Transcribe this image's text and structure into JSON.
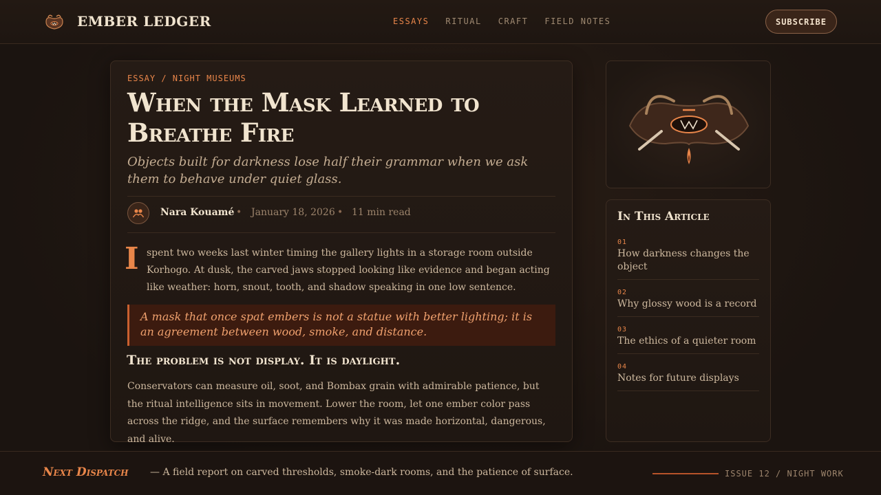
{
  "header": {
    "brand": "EMBER LEDGER",
    "brand_icon": "mask-icon",
    "nav": [
      {
        "label": "ESSAYS",
        "active": true
      },
      {
        "label": "RITUAL",
        "active": false
      },
      {
        "label": "CRAFT",
        "active": false
      },
      {
        "label": "FIELD NOTES",
        "active": false
      }
    ],
    "subscribe_label": "SUBSCRIBE"
  },
  "article": {
    "kicker": "ESSAY / NIGHT MUSEUMS",
    "title": "When the Mask Learned to Breathe Fire",
    "subtitle": "Objects built for darkness lose half their grammar when we ask them to behave under quiet glass.",
    "author": "Nara Kouamé",
    "separator": "•",
    "date": "January 18, 2026",
    "read_time": "11 min read",
    "dropcap": "I",
    "intro": "spent two weeks last winter timing the gallery lights in a storage room outside Korhogo. At dusk, the carved jaws stopped looking like evidence and began acting like weather: horn, snout, tooth, and shadow speaking in one low sentence.",
    "pullquote": "A mask that once spat embers is not a statue with better lighting; it is an agreement between wood, smoke, and distance.",
    "section_heading": "The problem is not display. It is daylight.",
    "body": "Conservators can measure oil, soot, and Bombax grain with admirable patience, but the ritual intelligence sits in movement. Lower the room, let one ember color pass across the ridge, and the surface remembers why it was made horizontal, dangerous, and alive."
  },
  "sidebar": {
    "illustration_icon": "fire-mask-icon",
    "toc_title": "In This Article",
    "toc": [
      {
        "num": "01",
        "label": "How darkness changes the object"
      },
      {
        "num": "02",
        "label": "Why glossy wood is a record"
      },
      {
        "num": "03",
        "label": "The ethics of a quieter room"
      },
      {
        "num": "04",
        "label": "Notes for future displays"
      }
    ]
  },
  "footer": {
    "label": "Next Dispatch",
    "text": "— A field report on carved thresholds, smoke-dark rooms, and the patience of surface.",
    "issue": "ISSUE 12 / NIGHT WORK"
  },
  "colors": {
    "accent": "#e9864a",
    "background": "#1d1511",
    "text": "#cdb89e",
    "heading": "#f1e4cf",
    "quote_bg": "#3c1b0f"
  }
}
